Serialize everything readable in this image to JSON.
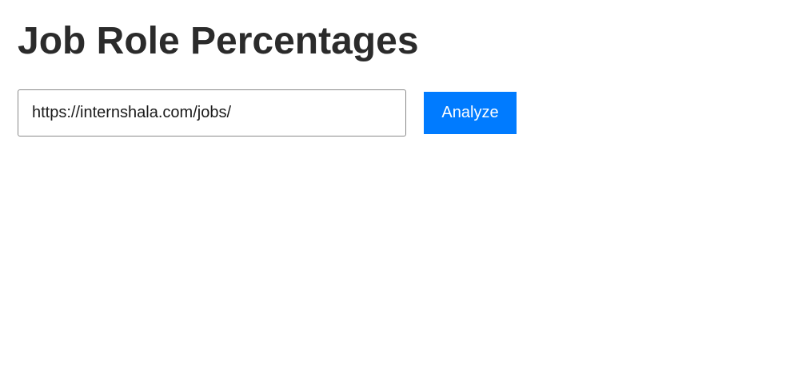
{
  "header": {
    "title": "Job Role Percentages"
  },
  "form": {
    "url_value": "https://internshala.com/jobs/",
    "analyze_label": "Analyze"
  },
  "colors": {
    "accent": "#007bff",
    "title_text": "#2b2b2b"
  }
}
